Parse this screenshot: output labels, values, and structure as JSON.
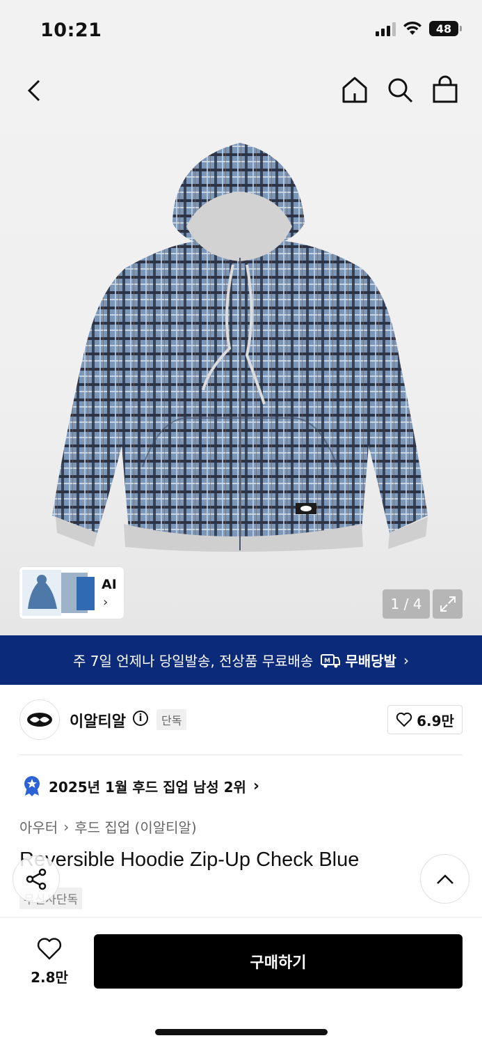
{
  "status_bar": {
    "time": "10:21",
    "battery": "48"
  },
  "gallery": {
    "ai_label": "AI",
    "pager": "1 / 4"
  },
  "banner": {
    "text": "주 7일 언제나 당일발송, 전상품 무료배송",
    "badge": "무배당발"
  },
  "brand": {
    "name": "이알티알",
    "badge": "단독",
    "likes": "6.9만"
  },
  "ranking": {
    "text": "2025년 1월 후드 집업 남성 2위"
  },
  "breadcrumb": [
    "아우터",
    "후드 집업 (이알티알)"
  ],
  "product": {
    "title": "Reversible Hoodie Zip-Up Check Blue",
    "tag": "무신사단독"
  },
  "bottom": {
    "wish_count": "2.8만",
    "buy_label": "구매하기"
  },
  "colors": {
    "banner": "#0b2a7a",
    "buy": "#000000",
    "check_blue": "#6f8db2",
    "rank_badge": "#2b63d6"
  }
}
